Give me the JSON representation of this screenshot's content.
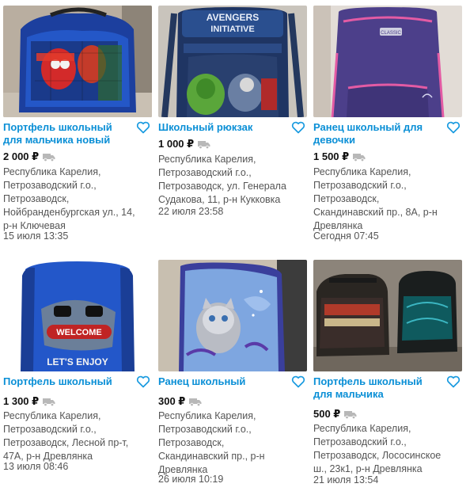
{
  "listings": [
    {
      "title": "Портфель школьный\nдля мальчика новый",
      "price": "2 000 ₽",
      "location": "Республика Карелия,\nПетрозаводский г.о.,\nПетрозаводск,\nНойбранденбургская ул., 14,\nр-н Ключевая",
      "date": "15 июля 13:35",
      "icon_favorite": "heart-outline-icon",
      "icon_delivery": "truck-icon"
    },
    {
      "title": "Школьный рюкзак",
      "price": "1 000 ₽",
      "location": "Республика Карелия,\nПетрозаводский г.о.,\nПетрозаводск, ул. Генерала\nСудакова, 11, р-н Кукковка",
      "date": "22 июля 23:58",
      "image_text": "AVENGERS\nINITIATIVE",
      "icon_favorite": "heart-outline-icon",
      "icon_delivery": "truck-icon"
    },
    {
      "title": "Ранец школьный для\nдевочки",
      "price": "1 500 ₽",
      "location": "Республика Карелия,\nПетрозаводский г.о.,\nПетрозаводск,\nСкандинавский пр., 8А, р-н\nДревлянка",
      "date": "Сегодня 07:45",
      "image_text": "CLASSIC",
      "icon_favorite": "heart-outline-icon",
      "icon_delivery": "truck-icon"
    },
    {
      "title": "Портфель школьный",
      "price": "1 300 ₽",
      "location": "Республика Карелия,\nПетрозаводский г.о.,\nПетрозаводск, Лесной пр-т,\n47А, р-н Древлянка",
      "date": "13 июля 08:46",
      "image_text": "WELCOME",
      "image_text_2": "LET'S ENJOY",
      "icon_favorite": "heart-outline-icon",
      "icon_delivery": "truck-icon"
    },
    {
      "title": "Ранец школьный",
      "price": "300 ₽",
      "location": "Республика Карелия,\nПетрозаводский г.о.,\nПетрозаводск,\nСкандинавский пр., р-н\nДревлянка",
      "date": "26 июля 10:19",
      "icon_favorite": "heart-outline-icon",
      "icon_delivery": "truck-icon"
    },
    {
      "title": "Портфель школьный\nдля мальчика",
      "price": "500 ₽",
      "location": "Республика Карелия,\nПетрозаводский г.о.,\nПетрозаводск, Лососинское\nш., 23к1, р-н Древлянка",
      "date": "21 июля 13:54",
      "icon_favorite": "heart-outline-icon",
      "icon_delivery": "truck-icon"
    }
  ],
  "colors": {
    "link": "#0a8fd6",
    "heart": "#1a9be0",
    "price": "#111111",
    "meta": "#555555",
    "truck": "#b8b8b8"
  }
}
